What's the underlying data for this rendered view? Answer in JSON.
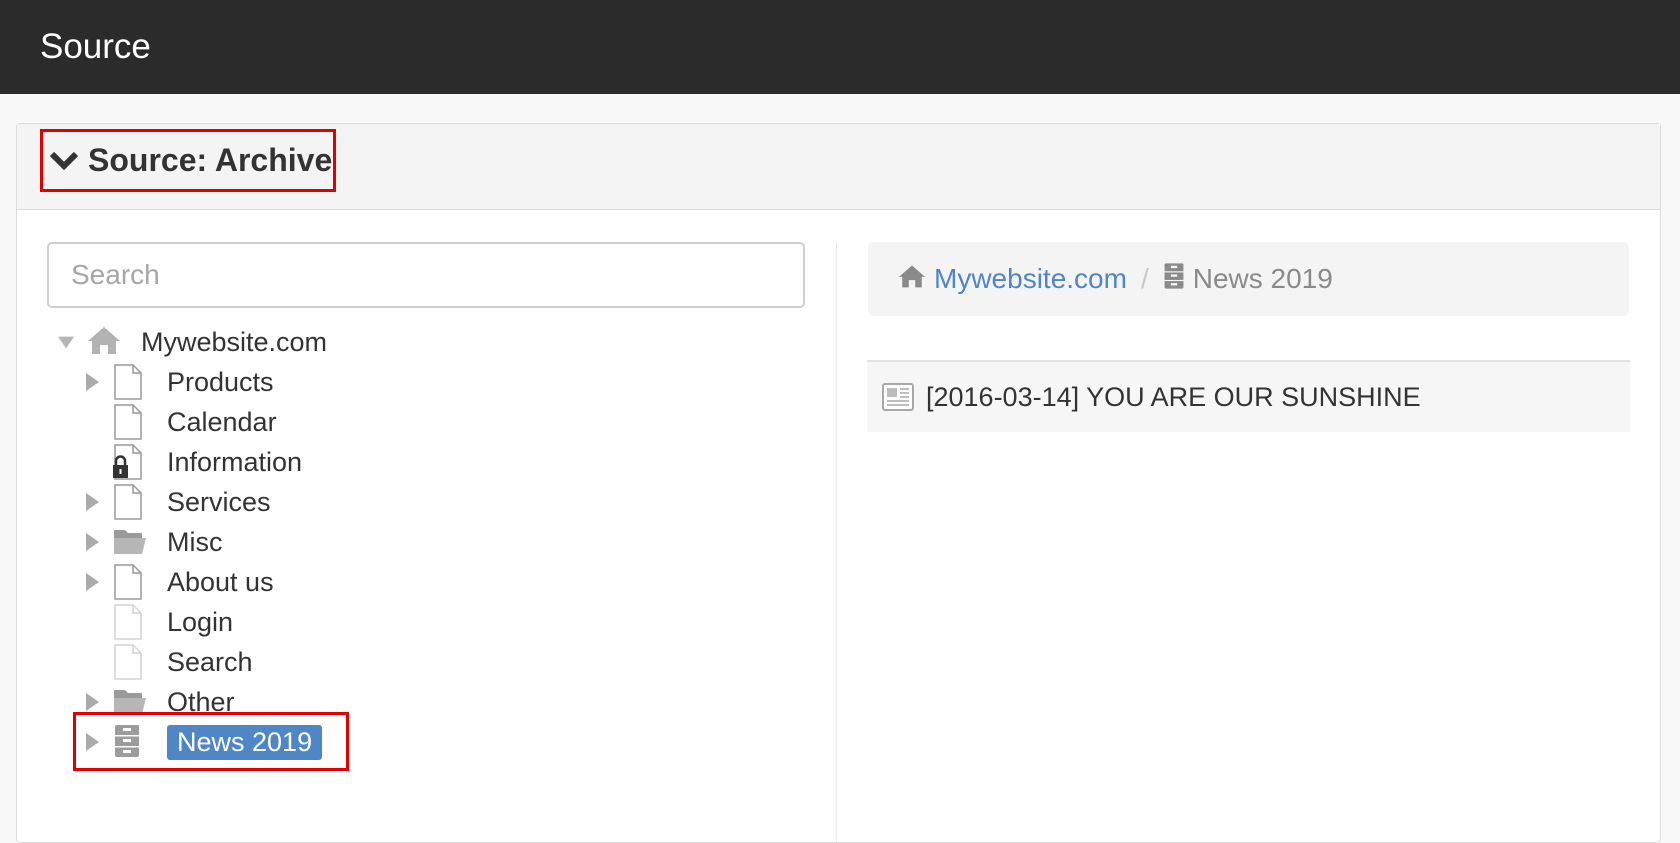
{
  "header": {
    "title": "Source"
  },
  "panel": {
    "heading": "Source: Archive"
  },
  "search": {
    "placeholder": "Search"
  },
  "tree": {
    "root": {
      "label": "Mywebsite.com",
      "icon": "home-icon"
    },
    "items": [
      {
        "label": "Products",
        "icon": "page-icon",
        "expandable": true
      },
      {
        "label": "Calendar",
        "icon": "page-icon",
        "expandable": false
      },
      {
        "label": "Information",
        "icon": "locked-page-icon",
        "expandable": false
      },
      {
        "label": "Services",
        "icon": "page-icon",
        "expandable": true
      },
      {
        "label": "Misc",
        "icon": "folder-icon",
        "expandable": true
      },
      {
        "label": "About us",
        "icon": "page-icon",
        "expandable": true
      },
      {
        "label": "Login",
        "icon": "hidden-page-icon",
        "expandable": false
      },
      {
        "label": "Search",
        "icon": "hidden-page-icon",
        "expandable": false
      },
      {
        "label": "Other",
        "icon": "folder-icon",
        "expandable": true
      },
      {
        "label": "News 2019",
        "icon": "archive-icon",
        "expandable": true,
        "selected": true
      }
    ]
  },
  "breadcrumb": {
    "home": "Mywebsite.com",
    "current": "News 2019"
  },
  "content": {
    "items": [
      {
        "label": "[2016-03-14] YOU ARE OUR SUNSHINE",
        "icon": "news-icon"
      }
    ]
  },
  "colors": {
    "accent": "#4f86c6",
    "highlight_border": "#e00000",
    "topbar": "#2b2b2b"
  }
}
